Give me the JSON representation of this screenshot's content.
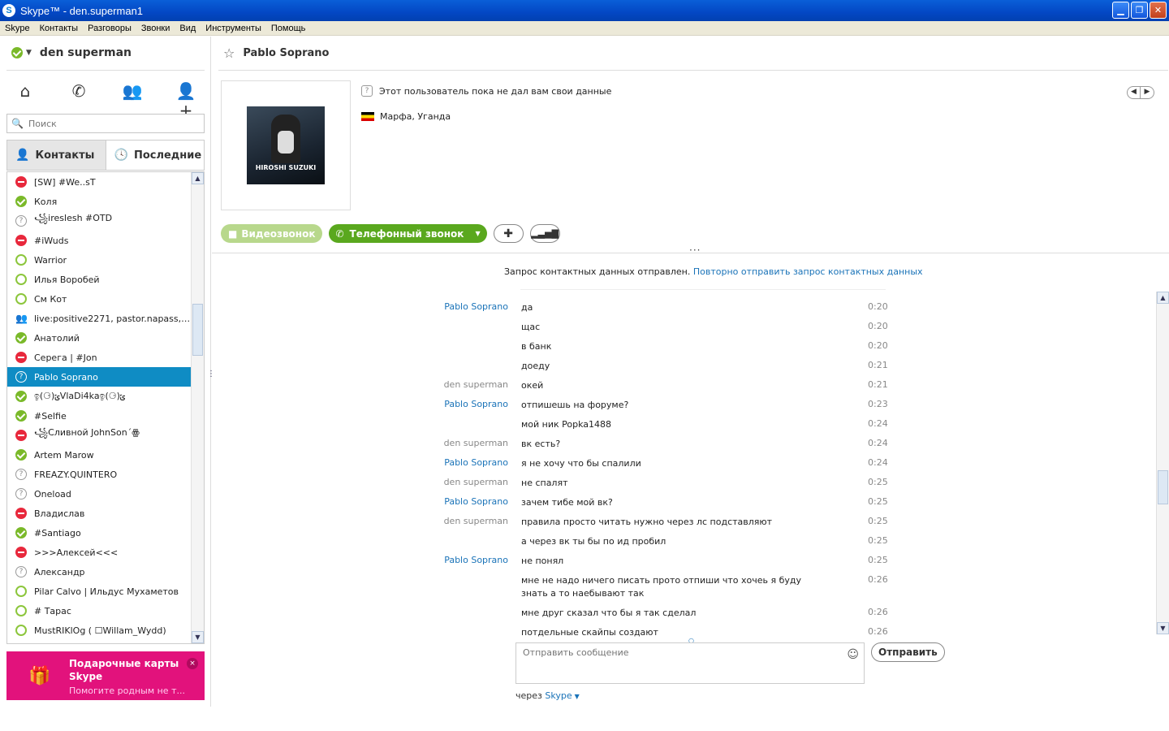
{
  "window": {
    "title": "Skype™ - den.superman1",
    "logo": "S"
  },
  "menu": [
    "Skype",
    "Контакты",
    "Разговоры",
    "Звонки",
    "Вид",
    "Инструменты",
    "Помощь"
  ],
  "user": {
    "name": "den superman",
    "status": "online"
  },
  "search": {
    "placeholder": "Поиск"
  },
  "tabs": {
    "contacts": "Контакты",
    "recent": "Последние"
  },
  "contacts": [
    {
      "name": "[SW] #We..sT",
      "status": "busy"
    },
    {
      "name": "Коля",
      "status": "online"
    },
    {
      "name": "꧁ireslesh #OTD",
      "status": "unknown"
    },
    {
      "name": "#iWuds",
      "status": "busy"
    },
    {
      "name": "Warrior",
      "status": "offline"
    },
    {
      "name": "Илья Воробей",
      "status": "offline"
    },
    {
      "name": "См Кот",
      "status": "offline"
    },
    {
      "name": "live:positive2271, pastor.napass, nu...",
      "status": "group"
    },
    {
      "name": "Анатолий",
      "status": "online"
    },
    {
      "name": "Серега | #Jon",
      "status": "busy"
    },
    {
      "name": "Pablo Soprano",
      "status": "unknown",
      "selected": true
    },
    {
      "name": "ඉ(⚆)ݶVlaDi4kaඉ(⚆)ݶ",
      "status": "online"
    },
    {
      "name": "#Selfie",
      "status": "online"
    },
    {
      "name": "꧁Сливной JohnSon´ꙮ",
      "status": "busy"
    },
    {
      "name": "Artem Marow",
      "status": "online"
    },
    {
      "name": "FREAZY.QUINTERO",
      "status": "unknown"
    },
    {
      "name": "Oneload",
      "status": "unknown"
    },
    {
      "name": "Владислав",
      "status": "busy"
    },
    {
      "name": "#Santiago",
      "status": "online"
    },
    {
      "name": ">>>Алексей<<<",
      "status": "busy"
    },
    {
      "name": "Александр",
      "status": "unknown"
    },
    {
      "name": "Pilar Calvo | Ильдус Мухаметов",
      "status": "offline"
    },
    {
      "name": "# Тарас",
      "status": "offline"
    },
    {
      "name": "MustRIKlOg ( ☐Willam_Wydd)",
      "status": "offline"
    }
  ],
  "promo": {
    "title": "Подарочные карты Skype",
    "subtitle": "Помогите родным не т...",
    "close": "×"
  },
  "chat": {
    "contact_name": "Pablo Soprano",
    "profile_note": "Этот пользователь пока не дал вам свои данные",
    "location": "Марфа, Уганда",
    "avatar_text": "HIROSHI SUZUKI",
    "video_btn": "Видеозвонок",
    "phone_btn": "Телефонный звонок",
    "notice": "Запрос контактных данных отправлен.",
    "notice_link": "Повторно отправить запрос контактных данных",
    "compose_placeholder": "Отправить сообщение",
    "send_btn": "Отправить",
    "via_label": "через",
    "via_link": "Skype"
  },
  "messages": [
    {
      "who": "Pablo Soprano",
      "text": "да",
      "time": "0:20"
    },
    {
      "who": "",
      "text": "щас",
      "time": "0:20"
    },
    {
      "who": "",
      "text": "в банк",
      "time": "0:20"
    },
    {
      "who": "",
      "text": "доеду",
      "time": "0:21"
    },
    {
      "who": "den superman",
      "text": "окей",
      "time": "0:21"
    },
    {
      "who": "Pablo Soprano",
      "text": "отпишешь на форуме?",
      "time": "0:23"
    },
    {
      "who": "",
      "text": "мой ник Popka1488",
      "time": "0:24"
    },
    {
      "who": "den superman",
      "text": "вк есть?",
      "time": "0:24"
    },
    {
      "who": "Pablo Soprano",
      "text": "я не хочу что бы спалили",
      "time": "0:24"
    },
    {
      "who": "den superman",
      "text": "не спалят",
      "time": "0:25"
    },
    {
      "who": "Pablo Soprano",
      "text": "зачем тибе мой вк?",
      "time": "0:25"
    },
    {
      "who": "den superman",
      "text": "правила просто читать нужно через лс подставляют",
      "time": "0:25"
    },
    {
      "who": "",
      "text": "а через вк ты бы по ид пробил",
      "time": "0:25"
    },
    {
      "who": "Pablo Soprano",
      "text": "не понял",
      "time": "0:25"
    },
    {
      "who": "",
      "text": "мне не надо ничего писать прото отпиши что хочеь я буду знать а то наебывают так",
      "time": "0:26"
    },
    {
      "who": "",
      "text": "мне друг сказал что бы я так сделал",
      "time": "0:26"
    },
    {
      "who": "",
      "text": "потдельные скайпы создают",
      "time": "0:26"
    }
  ],
  "colors": {
    "accent": "#0f8cc4",
    "online": "#7ab929",
    "busy": "#e8283c",
    "promo": "#e2127c",
    "call": "#5aa81e",
    "link": "#1a73b8"
  }
}
